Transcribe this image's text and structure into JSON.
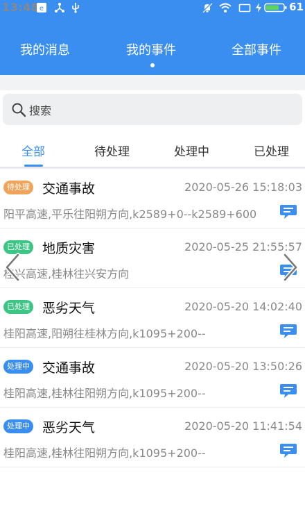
{
  "status_bar": {
    "time": "13:48",
    "battery": "61",
    "icons": [
      "app-icon",
      "share-icon",
      "usb-icon",
      "mute-icon",
      "wifi-icon",
      "screen-icon",
      "charging-icon",
      "battery-icon"
    ]
  },
  "top_tabs": [
    {
      "label": "我的消息",
      "active": false
    },
    {
      "label": "我的事件",
      "active": true
    },
    {
      "label": "全部事件",
      "active": false
    }
  ],
  "search": {
    "placeholder": "搜索",
    "icon": "search-icon"
  },
  "filter_tabs": [
    {
      "label": "全部",
      "active": true
    },
    {
      "label": "待处理",
      "active": false
    },
    {
      "label": "处理中",
      "active": false
    },
    {
      "label": "已处理",
      "active": false
    }
  ],
  "events": [
    {
      "status": "待处理",
      "status_color": "#f0a35a",
      "title": "交通事故",
      "time": "2020-05-26 15:18:03",
      "location": "阳平高速,平乐往阳朔方向,k2589+0--k2589+600"
    },
    {
      "status": "已处理",
      "status_color": "#3dc585",
      "title": "地质灾害",
      "time": "2020-05-25 21:55:57",
      "location": "桂兴高速,桂林往兴安方向"
    },
    {
      "status": "已处理",
      "status_color": "#3dc585",
      "title": "恶劣天气",
      "time": "2020-05-20 14:02:40",
      "location": "桂阳高速,阳朔往桂林方向,k1095+200--"
    },
    {
      "status": "处理中",
      "status_color": "#3a8ef0",
      "title": "交通事故",
      "time": "2020-05-20 13:50:26",
      "location": "桂阳高速,桂林往阳朔方向,k1095+200--"
    },
    {
      "status": "处理中",
      "status_color": "#3a8ef0",
      "title": "恶劣天气",
      "time": "2020-05-20 11:41:54",
      "location": "桂阳高速,桂林往阳朔方向,k1095+200--"
    }
  ],
  "colors": {
    "accent": "#3a8ef0",
    "pending": "#f0a35a",
    "done": "#3dc585",
    "processing": "#3a8ef0"
  }
}
